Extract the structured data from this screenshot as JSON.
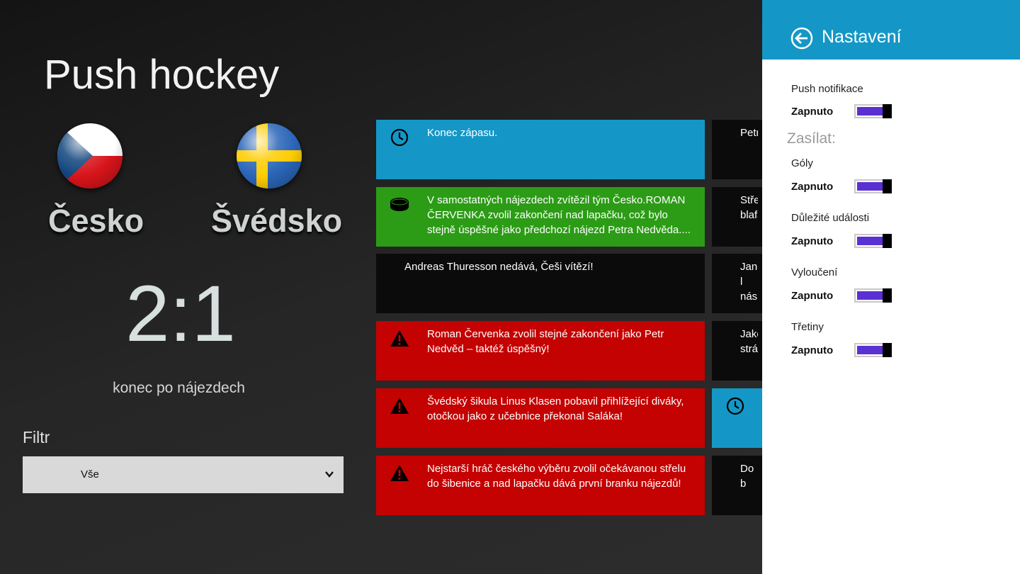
{
  "app": {
    "title": "Push hockey"
  },
  "match": {
    "home_team": "Česko",
    "away_team": "Švédsko",
    "score": "2:1",
    "status": "konec po nájezdech"
  },
  "filter": {
    "label": "Filtr",
    "selected": "Vše"
  },
  "feed": {
    "col1": [
      {
        "icon": "clock-icon",
        "color": "#1497c6",
        "text": "Konec zápasu."
      },
      {
        "icon": "puck-icon",
        "color": "#2c9c16",
        "text": "V samostatných nájezdech zvítězil tým Česko.ROMAN ČERVENKA zvolil zakončení nad lapačku, což bylo stejně úspěšné jako předchozí nájezd Petra Nedvěda...."
      },
      {
        "icon": "",
        "color": "#0b0b0b",
        "text": "Andreas Thuresson nedává, Češi vítězí!"
      },
      {
        "icon": "warning-icon",
        "color": "#c40202",
        "text": "Roman Červenka zvolil stejné zakončení jako Petr Nedvěd – taktéž úspěšný!"
      },
      {
        "icon": "warning-icon",
        "color": "#c40202",
        "text": "Švédský šikula Linus Klasen pobavil přihlížející diváky, otočkou jako z učebnice překonal Saláka!"
      },
      {
        "icon": "warning-icon",
        "color": "#c40202",
        "text": "Nejstarší hráč českého výběru zvolil očekávanou střelu do šibenice a nad lapačku dává první branku nájezdů!"
      }
    ],
    "col2": [
      {
        "text": "Petr"
      },
      {
        "text": "Střel blafá"
      },
      {
        "text": "Jan l násle"
      },
      {
        "text": "Jako stráž"
      },
      {
        "text": ""
      },
      {
        "text": "Do b"
      }
    ]
  },
  "settings": {
    "title": "Nastavení",
    "push_label": "Push notifikace",
    "push_state": "Zapnuto",
    "send_label": "Zasílat:",
    "items": [
      {
        "label": "Góly",
        "state": "Zapnuto"
      },
      {
        "label": "Důležité události",
        "state": "Zapnuto"
      },
      {
        "label": "Vyloučení",
        "state": "Zapnuto"
      },
      {
        "label": "Třetiny",
        "state": "Zapnuto"
      }
    ],
    "toggle_color": "#5b30d2"
  }
}
